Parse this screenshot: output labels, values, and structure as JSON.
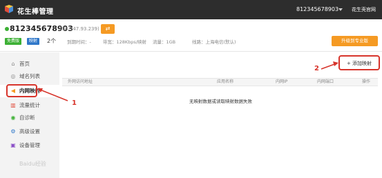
{
  "app": {
    "title": "花生棒管理",
    "account": "812345678903",
    "official_site": "花生壳官网"
  },
  "device": {
    "id": "812345678903",
    "ip": "(14.147.93.239)",
    "edit_icon": "swap-icon",
    "badge_free": "免费版",
    "badge_map": "映射",
    "map_count": "2个",
    "expire": "到期时间：-",
    "bandwidth": "带宽：128Kbps/映射",
    "traffic": "流量：1GB",
    "line": "线路：上海电信(默认)",
    "upgrade_label": "升级到专业版"
  },
  "sidebar": {
    "items": [
      {
        "label": "首页",
        "icon": "home-icon",
        "glyph": "⌂"
      },
      {
        "label": "域名列表",
        "icon": "globe-icon",
        "glyph": "◎"
      },
      {
        "label": "内网映射",
        "icon": "speaker-icon",
        "glyph": "◀"
      },
      {
        "label": "流量统计",
        "icon": "bar-chart-icon",
        "glyph": "▥"
      },
      {
        "label": "自诊断",
        "icon": "diagnose-icon",
        "glyph": "◉"
      },
      {
        "label": "高级设置",
        "icon": "gear-icon",
        "glyph": "⚙"
      },
      {
        "label": "设备管理",
        "icon": "device-icon",
        "glyph": "▣"
      }
    ]
  },
  "content": {
    "add_mapping": "+ 添加映射",
    "columns": [
      "外网访问地址",
      "应用名称",
      "内网IP",
      "内网端口",
      "操作"
    ],
    "empty_message": "无映射数据或读取映射数据失败"
  },
  "annotations": {
    "step1": "1",
    "step2": "2"
  },
  "watermark": "Baidu经验",
  "colors": {
    "topbar": "#2d2d2d",
    "accent_orange": "#f59a23",
    "status_green": "#3cb034",
    "annotation_red": "#d7342b"
  }
}
